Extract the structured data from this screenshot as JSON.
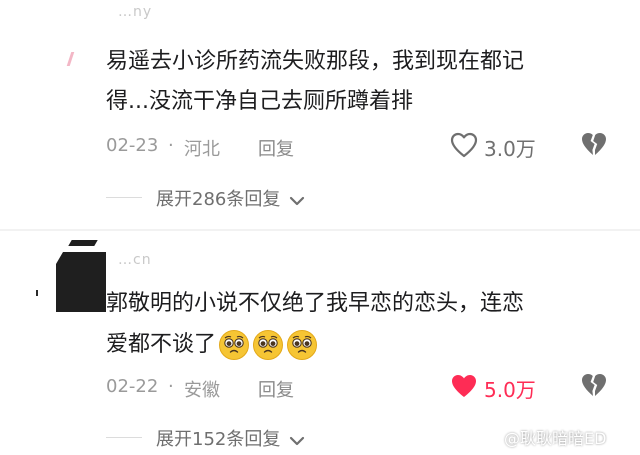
{
  "comments": [
    {
      "author_faded": "…ny",
      "text_line1": "易遥去小诊所药流失败那段，我到现在都记",
      "text_line2": "得...没流干净自己去厕所蹲着排",
      "date": "02-23",
      "location": "河北",
      "reply_label": "回复",
      "likes": "3.0万",
      "liked": false,
      "expand_label": "展开286条回复"
    },
    {
      "author_faded": "…cn",
      "text_line1": "郭敬明的小说不仅绝了我早恋的恋头，连恋",
      "text_line2": "爱都不谈了",
      "emojis": [
        "pleading-face-emoji",
        "pleading-face-emoji",
        "pleading-face-emoji"
      ],
      "date": "02-22",
      "location": "安徽",
      "reply_label": "回复",
      "likes": "5.0万",
      "liked": true,
      "expand_label": "展开152条回复"
    }
  ],
  "separator": "·",
  "watermark": "@耿耿暗暗ED",
  "colors": {
    "liked": "#fe2c55",
    "meta": "#9a9a9a",
    "text": "#1d1d1f"
  }
}
